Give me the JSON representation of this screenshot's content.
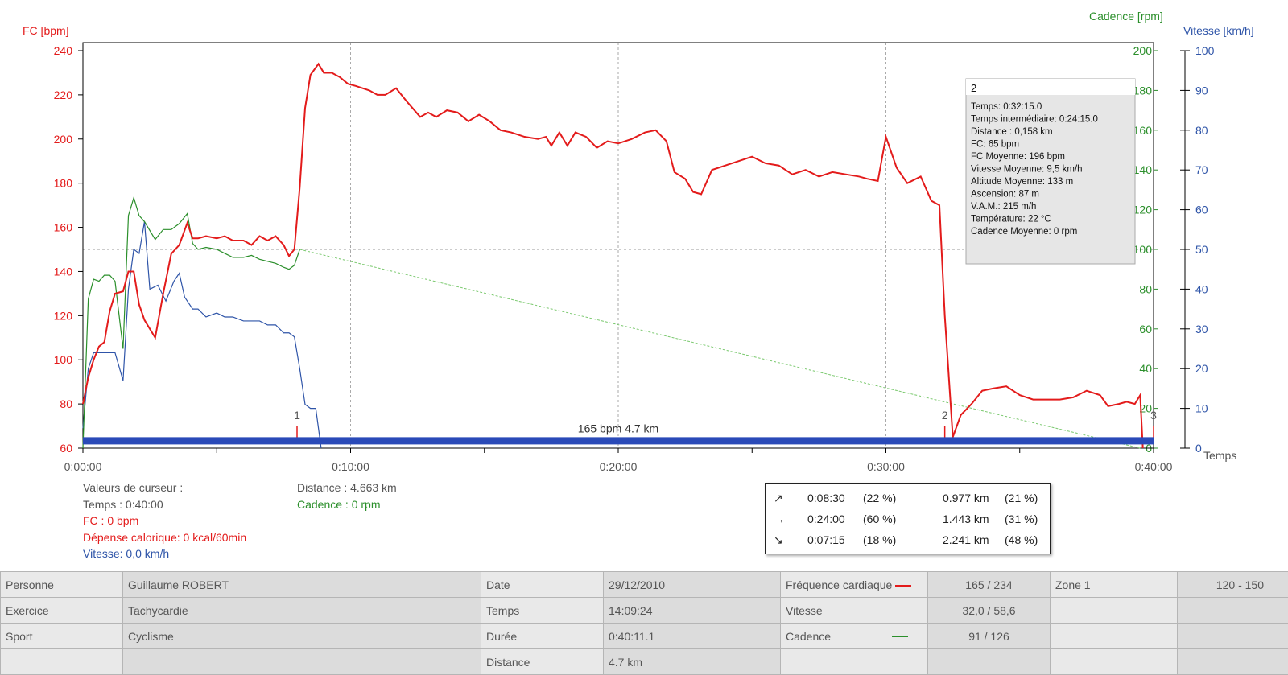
{
  "colors": {
    "hr": "#e31b1b",
    "cadence": "#2b8f2b",
    "speed": "#2e54a8",
    "bar": "#2a4ab8"
  },
  "chart_data": {
    "type": "line",
    "x_unit": "Temps",
    "x_ticks": [
      "0:00:00",
      "0:10:00",
      "0:20:00",
      "0:30:00",
      "0:40:00"
    ],
    "xlim": [
      0,
      40
    ],
    "axes": {
      "left": {
        "label": "FC [bpm]",
        "ylim": [
          60,
          240
        ],
        "ticks": [
          60,
          80,
          100,
          120,
          140,
          160,
          180,
          200,
          220,
          240
        ]
      },
      "right1": {
        "label": "Cadence [rpm]",
        "ylim": [
          0,
          200
        ],
        "ticks": [
          0,
          20,
          40,
          60,
          80,
          100,
          120,
          140,
          160,
          180,
          200
        ]
      },
      "right2": {
        "label": "Vitesse [km/h]",
        "ylim": [
          0,
          100
        ],
        "ticks": [
          0,
          10,
          20,
          30,
          40,
          50,
          60,
          70,
          80,
          90,
          100
        ]
      }
    },
    "grid": true,
    "series": [
      {
        "name": "Fréquence cardiaque",
        "axis": "left",
        "points": [
          [
            0,
            80
          ],
          [
            0.2,
            92
          ],
          [
            0.4,
            100
          ],
          [
            0.6,
            106
          ],
          [
            0.8,
            108
          ],
          [
            1.0,
            122
          ],
          [
            1.2,
            130
          ],
          [
            1.5,
            131
          ],
          [
            1.7,
            140
          ],
          [
            1.9,
            140
          ],
          [
            2.1,
            125
          ],
          [
            2.3,
            118
          ],
          [
            2.7,
            110
          ],
          [
            3.0,
            130
          ],
          [
            3.3,
            148
          ],
          [
            3.6,
            152
          ],
          [
            3.9,
            162
          ],
          [
            4.1,
            155
          ],
          [
            4.3,
            155
          ],
          [
            4.6,
            156
          ],
          [
            5.0,
            155
          ],
          [
            5.3,
            156
          ],
          [
            5.6,
            154
          ],
          [
            6.0,
            154
          ],
          [
            6.3,
            152
          ],
          [
            6.6,
            156
          ],
          [
            6.9,
            154
          ],
          [
            7.2,
            156
          ],
          [
            7.5,
            152
          ],
          [
            7.7,
            147
          ],
          [
            7.9,
            150
          ],
          [
            8.1,
            178
          ],
          [
            8.3,
            214
          ],
          [
            8.5,
            229
          ],
          [
            8.8,
            234
          ],
          [
            9.0,
            230
          ],
          [
            9.3,
            230
          ],
          [
            9.6,
            228
          ],
          [
            9.9,
            225
          ],
          [
            10.2,
            224
          ],
          [
            10.7,
            222
          ],
          [
            11.0,
            220
          ],
          [
            11.3,
            220
          ],
          [
            11.7,
            223
          ],
          [
            12.1,
            217
          ],
          [
            12.6,
            210
          ],
          [
            12.9,
            212
          ],
          [
            13.2,
            210
          ],
          [
            13.6,
            213
          ],
          [
            14.0,
            212
          ],
          [
            14.4,
            208
          ],
          [
            14.8,
            211
          ],
          [
            15.2,
            208
          ],
          [
            15.6,
            204
          ],
          [
            16.0,
            203
          ],
          [
            16.5,
            201
          ],
          [
            17.0,
            200
          ],
          [
            17.3,
            201
          ],
          [
            17.5,
            197
          ],
          [
            17.8,
            203
          ],
          [
            18.1,
            197
          ],
          [
            18.4,
            203
          ],
          [
            18.8,
            201
          ],
          [
            19.2,
            196
          ],
          [
            19.6,
            199
          ],
          [
            20.0,
            198
          ],
          [
            20.5,
            200
          ],
          [
            21.0,
            203
          ],
          [
            21.4,
            204
          ],
          [
            21.8,
            199
          ],
          [
            22.1,
            185
          ],
          [
            22.5,
            182
          ],
          [
            22.8,
            176
          ],
          [
            23.1,
            175
          ],
          [
            23.5,
            186
          ],
          [
            24.0,
            188
          ],
          [
            24.5,
            190
          ],
          [
            25.0,
            192
          ],
          [
            25.5,
            189
          ],
          [
            26.0,
            188
          ],
          [
            26.5,
            184
          ],
          [
            27.0,
            186
          ],
          [
            27.5,
            183
          ],
          [
            28.0,
            185
          ],
          [
            28.5,
            184
          ],
          [
            29.0,
            183
          ],
          [
            29.3,
            182
          ],
          [
            29.7,
            181
          ],
          [
            30.0,
            201
          ],
          [
            30.4,
            187
          ],
          [
            30.8,
            180
          ],
          [
            31.3,
            183
          ],
          [
            31.7,
            172
          ],
          [
            32.0,
            170
          ],
          [
            32.2,
            120
          ],
          [
            32.5,
            65
          ],
          [
            32.8,
            75
          ],
          [
            33.2,
            80
          ],
          [
            33.6,
            86
          ],
          [
            34.0,
            87
          ],
          [
            34.5,
            88
          ],
          [
            35.0,
            84
          ],
          [
            35.5,
            82
          ],
          [
            36.0,
            82
          ],
          [
            36.5,
            82
          ],
          [
            37.0,
            83
          ],
          [
            37.5,
            86
          ],
          [
            38.0,
            84
          ],
          [
            38.3,
            79
          ],
          [
            38.7,
            80
          ],
          [
            39.0,
            81
          ],
          [
            39.3,
            80
          ],
          [
            39.5,
            84
          ],
          [
            39.6,
            60
          ]
        ]
      },
      {
        "name": "Cadence",
        "axis": "right1",
        "points": [
          [
            0,
            0
          ],
          [
            0.2,
            75
          ],
          [
            0.4,
            85
          ],
          [
            0.6,
            84
          ],
          [
            0.8,
            87
          ],
          [
            1.0,
            87
          ],
          [
            1.2,
            84
          ],
          [
            1.5,
            50
          ],
          [
            1.7,
            117
          ],
          [
            1.9,
            126
          ],
          [
            2.1,
            117
          ],
          [
            2.3,
            114
          ],
          [
            2.7,
            105
          ],
          [
            3.0,
            110
          ],
          [
            3.3,
            110
          ],
          [
            3.6,
            113
          ],
          [
            3.9,
            118
          ],
          [
            4.1,
            103
          ],
          [
            4.3,
            100
          ],
          [
            4.6,
            101
          ],
          [
            5.0,
            100
          ],
          [
            5.3,
            98
          ],
          [
            5.6,
            96
          ],
          [
            6.0,
            96
          ],
          [
            6.3,
            97
          ],
          [
            6.6,
            95
          ],
          [
            6.9,
            94
          ],
          [
            7.2,
            93
          ],
          [
            7.5,
            91
          ],
          [
            7.7,
            90
          ],
          [
            7.9,
            92
          ],
          [
            8.1,
            100
          ],
          [
            39.5,
            0
          ]
        ]
      },
      {
        "name": "Vitesse",
        "axis": "right2",
        "points": [
          [
            0,
            5
          ],
          [
            0.2,
            20
          ],
          [
            0.4,
            24
          ],
          [
            0.6,
            24
          ],
          [
            0.8,
            24
          ],
          [
            1.0,
            24
          ],
          [
            1.2,
            24
          ],
          [
            1.5,
            17
          ],
          [
            1.7,
            40
          ],
          [
            1.9,
            50
          ],
          [
            2.1,
            49
          ],
          [
            2.3,
            57
          ],
          [
            2.5,
            40
          ],
          [
            2.8,
            41
          ],
          [
            3.1,
            37
          ],
          [
            3.4,
            42
          ],
          [
            3.6,
            44
          ],
          [
            3.8,
            38
          ],
          [
            4.1,
            35
          ],
          [
            4.3,
            35
          ],
          [
            4.6,
            33
          ],
          [
            5.0,
            34
          ],
          [
            5.3,
            33
          ],
          [
            5.6,
            33
          ],
          [
            6.0,
            32
          ],
          [
            6.3,
            32
          ],
          [
            6.6,
            32
          ],
          [
            6.9,
            31
          ],
          [
            7.2,
            31
          ],
          [
            7.5,
            29
          ],
          [
            7.7,
            29
          ],
          [
            7.9,
            28
          ],
          [
            8.1,
            20
          ],
          [
            8.3,
            11
          ],
          [
            8.5,
            10
          ],
          [
            8.7,
            10
          ],
          [
            8.9,
            0
          ]
        ]
      }
    ],
    "markers": [
      {
        "label": "1",
        "x": 8.0
      },
      {
        "label": "2",
        "x": 32.2
      },
      {
        "label": "3",
        "x": 40.0
      }
    ],
    "band": {
      "label": "165 bpm 4.7 km",
      "x_start": 0,
      "x_end": 40
    },
    "tooltip": {
      "title": "2",
      "lines": [
        "Temps: 0:32:15.0",
        "Temps intermédiaire: 0:24:15.0",
        "Distance :  0,158 km",
        "FC: 65 bpm",
        "FC Moyenne:  196 bpm",
        "Vitesse Moyenne:  9,5 km/h",
        "Altitude Moyenne:  133 m",
        "Ascension:  87 m",
        "V.A.M.:  215 m/h",
        "Température:  22 °C",
        "Cadence Moyenne:  0 rpm"
      ]
    }
  },
  "cursor": {
    "title": "Valeurs de curseur :",
    "temps": "Temps : 0:40:00",
    "fc": "FC : 0 bpm",
    "calories": "Dépense calorique: 0 kcal/60min",
    "vitesse": "Vitesse: 0,0 km/h",
    "distance": "Distance : 4.663 km",
    "cadence": "Cadence : 0 rpm"
  },
  "summary": [
    {
      "icon": "↗",
      "icon_name": "arrow-up-right-icon",
      "time": "0:08:30",
      "time_pct": "(22 %)",
      "dist": "0.977 km",
      "dist_pct": "(21 %)"
    },
    {
      "icon": "→",
      "icon_name": "arrow-right-icon",
      "time": "0:24:00",
      "time_pct": "(60 %)",
      "dist": "1.443 km",
      "dist_pct": "(31 %)"
    },
    {
      "icon": "↘",
      "icon_name": "arrow-down-right-icon",
      "time": "0:07:15",
      "time_pct": "(18 %)",
      "dist": "2.241 km",
      "dist_pct": "(48 %)"
    }
  ],
  "info": {
    "personne_label": "Personne",
    "personne": "Guillaume ROBERT",
    "exercice_label": "Exercice",
    "exercice": "Tachycardie",
    "sport_label": "Sport",
    "sport": "Cyclisme",
    "date_label": "Date",
    "date": "29/12/2010",
    "temps_label": "Temps",
    "temps": "14:09:24",
    "duree_label": "Durée",
    "duree": "0:40:11.1",
    "distance_label": "Distance",
    "distance": "4.7 km",
    "fc_label": "Fréquence cardiaque",
    "fc": "165 / 234",
    "vitesse_label": "Vitesse",
    "vitesse": "32,0 / 58,6",
    "cadence_label": "Cadence",
    "cadence": "91 / 126",
    "zone_label": "Zone 1",
    "zone": "120 - 150"
  }
}
